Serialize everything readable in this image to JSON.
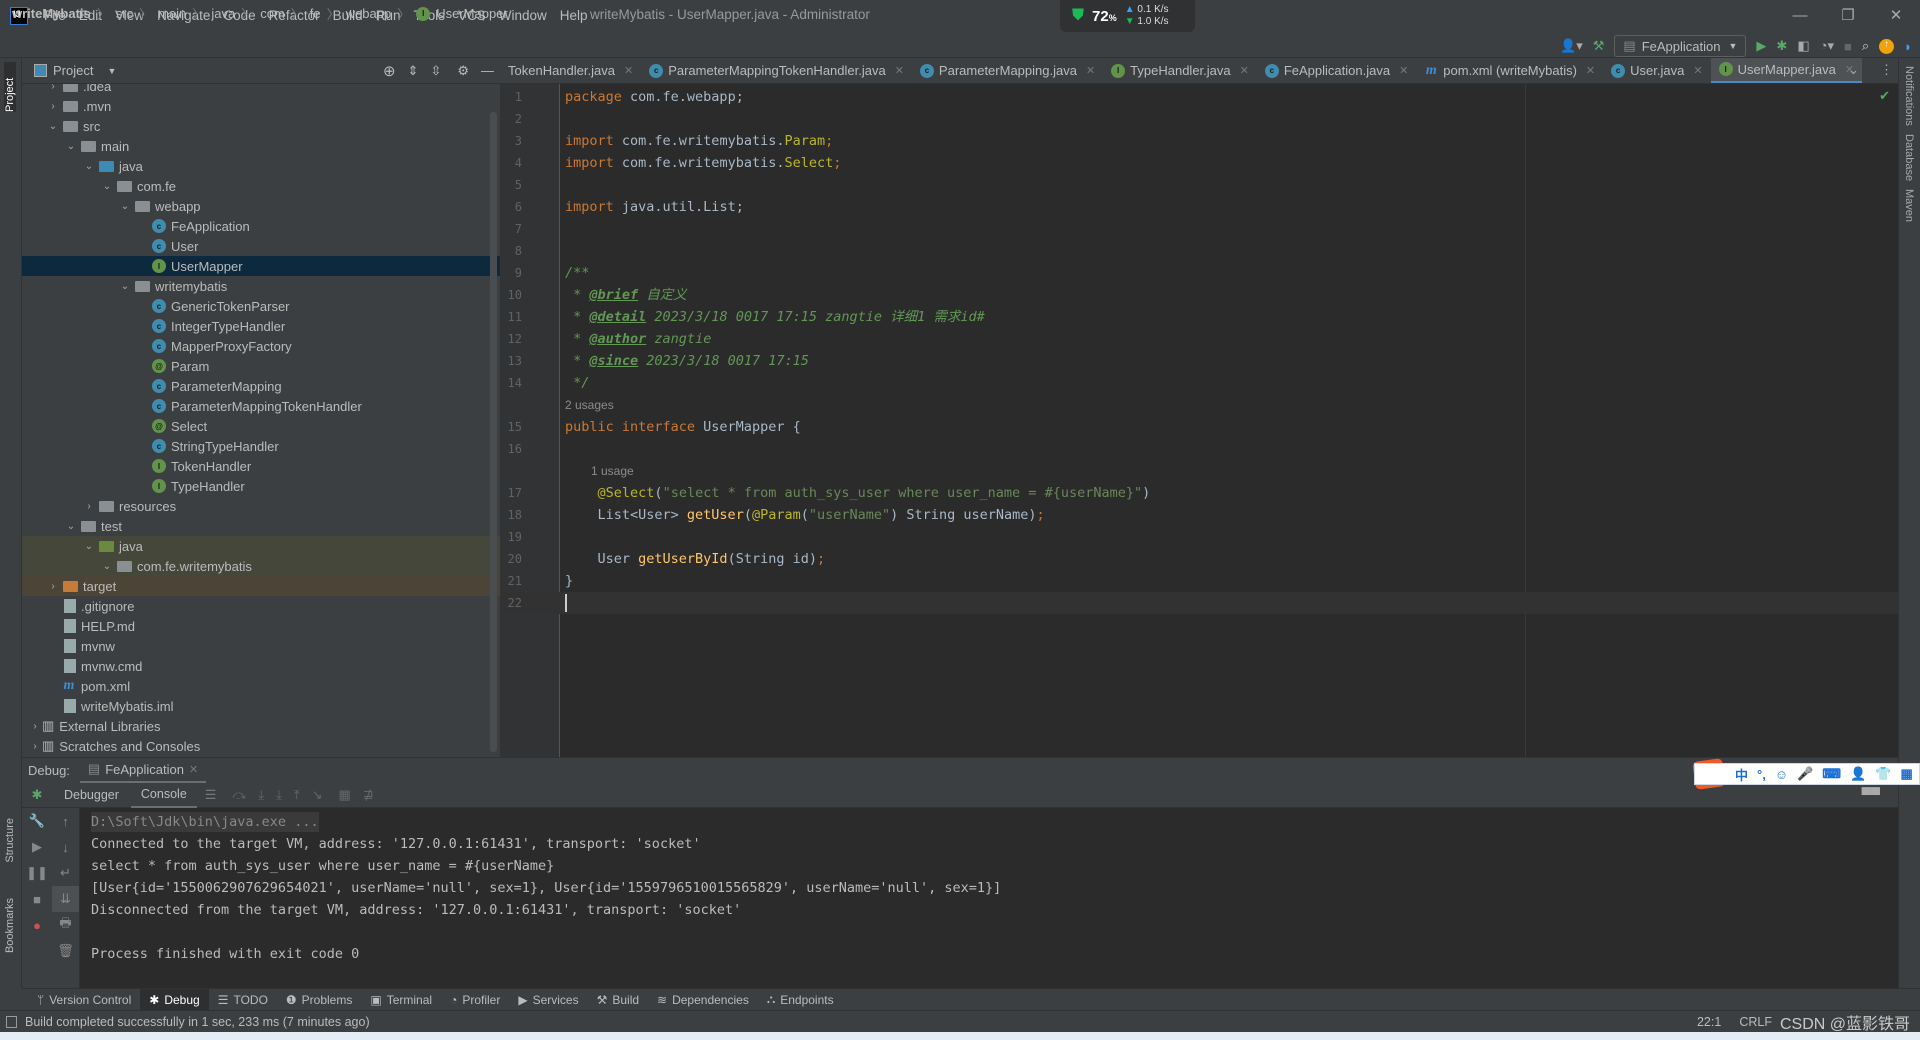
{
  "app": {
    "window_title": "writeMybatis - UserMapper.java - Administrator",
    "logo": "IJ"
  },
  "menu": [
    "File",
    "Edit",
    "View",
    "Navigate",
    "Code",
    "Refactor",
    "Build",
    "Run",
    "Tools",
    "VCS",
    "Window",
    "Help"
  ],
  "net_widget": {
    "cpu": "72",
    "cpu_unit": "%",
    "up": "0.1",
    "down": "1.0",
    "unit": "K/s"
  },
  "breadcrumb": [
    "writeMybatis",
    "src",
    "main",
    "java",
    "com",
    "fe",
    "webapp",
    "UserMapper"
  ],
  "run_config": "FeApplication",
  "left_strip": {
    "project": "Project",
    "structure": "Structure",
    "bookmarks": "Bookmarks"
  },
  "right_strip": [
    "Notifications",
    "Database",
    "Maven"
  ],
  "project_panel": {
    "title": "Project",
    "tree": [
      {
        "label": ".idea",
        "depth": 1,
        "kind": "folder",
        "chev": "›"
      },
      {
        "label": ".mvn",
        "depth": 1,
        "kind": "folder",
        "chev": "›"
      },
      {
        "label": "src",
        "depth": 1,
        "kind": "folder",
        "chev": "⌄"
      },
      {
        "label": "main",
        "depth": 2,
        "kind": "folder",
        "chev": "⌄"
      },
      {
        "label": "java",
        "depth": 3,
        "kind": "src",
        "chev": "⌄"
      },
      {
        "label": "com.fe",
        "depth": 4,
        "kind": "pkg",
        "chev": "⌄"
      },
      {
        "label": "webapp",
        "depth": 5,
        "kind": "pkg",
        "chev": "⌄"
      },
      {
        "label": "FeApplication",
        "depth": 6,
        "kind": "C"
      },
      {
        "label": "User",
        "depth": 6,
        "kind": "C"
      },
      {
        "label": "UserMapper",
        "depth": 6,
        "kind": "I",
        "selected": true
      },
      {
        "label": "writemybatis",
        "depth": 5,
        "kind": "pkg",
        "chev": "⌄"
      },
      {
        "label": "GenericTokenParser",
        "depth": 6,
        "kind": "C"
      },
      {
        "label": "IntegerTypeHandler",
        "depth": 6,
        "kind": "C"
      },
      {
        "label": "MapperProxyFactory",
        "depth": 6,
        "kind": "C"
      },
      {
        "label": "Param",
        "depth": 6,
        "kind": "A"
      },
      {
        "label": "ParameterMapping",
        "depth": 6,
        "kind": "C"
      },
      {
        "label": "ParameterMappingTokenHandler",
        "depth": 6,
        "kind": "C"
      },
      {
        "label": "Select",
        "depth": 6,
        "kind": "A"
      },
      {
        "label": "StringTypeHandler",
        "depth": 6,
        "kind": "C"
      },
      {
        "label": "TokenHandler",
        "depth": 6,
        "kind": "I"
      },
      {
        "label": "TypeHandler",
        "depth": 6,
        "kind": "I"
      },
      {
        "label": "resources",
        "depth": 3,
        "kind": "folder",
        "chev": "›"
      },
      {
        "label": "test",
        "depth": 2,
        "kind": "folder",
        "chev": "⌄"
      },
      {
        "label": "java",
        "depth": 3,
        "kind": "test",
        "chev": "⌄",
        "test": true
      },
      {
        "label": "com.fe.writemybatis",
        "depth": 4,
        "kind": "pkg",
        "chev": "⌄",
        "test": true
      },
      {
        "label": "target",
        "depth": 1,
        "kind": "tgt",
        "chev": "›",
        "excluded": true
      },
      {
        "label": ".gitignore",
        "depth": 1,
        "kind": "file"
      },
      {
        "label": "HELP.md",
        "depth": 1,
        "kind": "file"
      },
      {
        "label": "mvnw",
        "depth": 1,
        "kind": "file"
      },
      {
        "label": "mvnw.cmd",
        "depth": 1,
        "kind": "file"
      },
      {
        "label": "pom.xml",
        "depth": 1,
        "kind": "m"
      },
      {
        "label": "writeMybatis.iml",
        "depth": 1,
        "kind": "file"
      },
      {
        "label": "External Libraries",
        "depth": 0,
        "kind": "lib",
        "chev": "›"
      },
      {
        "label": "Scratches and Consoles",
        "depth": 0,
        "kind": "lib",
        "chev": "›"
      }
    ]
  },
  "editor_tabs": [
    {
      "label": "TokenHandler.java",
      "icon": "I"
    },
    {
      "label": "ParameterMappingTokenHandler.java",
      "icon": "C"
    },
    {
      "label": "ParameterMapping.java",
      "icon": "C"
    },
    {
      "label": "TypeHandler.java",
      "icon": "I"
    },
    {
      "label": "FeApplication.java",
      "icon": "C"
    },
    {
      "label": "pom.xml (writeMybatis)",
      "icon": "m"
    },
    {
      "label": "User.java",
      "icon": "C"
    },
    {
      "label": "UserMapper.java",
      "icon": "I",
      "active": true
    }
  ],
  "code": [
    {
      "n": "1",
      "tokens": [
        [
          "keyword",
          "package "
        ],
        [
          "plain",
          "com.fe.webapp;"
        ]
      ]
    },
    {
      "n": "2",
      "tokens": []
    },
    {
      "n": "3",
      "tokens": [
        [
          "keyword",
          "import "
        ],
        [
          "plain",
          "com.fe.writemybatis."
        ],
        [
          "annotation",
          "Param"
        ],
        [
          "keyword",
          ";"
        ]
      ]
    },
    {
      "n": "4",
      "tokens": [
        [
          "keyword",
          "import "
        ],
        [
          "plain",
          "com.fe.writemybatis."
        ],
        [
          "annotation",
          "Select"
        ],
        [
          "keyword",
          ";"
        ]
      ]
    },
    {
      "n": "5",
      "tokens": []
    },
    {
      "n": "6",
      "tokens": [
        [
          "keyword",
          "import "
        ],
        [
          "plain",
          "java.util.List;"
        ]
      ]
    },
    {
      "n": "7",
      "tokens": []
    },
    {
      "n": "8",
      "tokens": []
    },
    {
      "n": "9",
      "tokens": [
        [
          "doc",
          "/**"
        ]
      ]
    },
    {
      "n": "10",
      "tokens": [
        [
          "doc",
          " * "
        ],
        [
          "doctag",
          "@brief"
        ],
        [
          "doc",
          " 自定义"
        ]
      ]
    },
    {
      "n": "11",
      "tokens": [
        [
          "doc",
          " * "
        ],
        [
          "doctag",
          "@detail"
        ],
        [
          "doc",
          " 2023/3/18 0017 17:15 zangtie 详细1 需求id#"
        ]
      ]
    },
    {
      "n": "12",
      "tokens": [
        [
          "doc",
          " * "
        ],
        [
          "doctag",
          "@author"
        ],
        [
          "doc",
          " zangtie"
        ]
      ]
    },
    {
      "n": "13",
      "tokens": [
        [
          "doc",
          " * "
        ],
        [
          "doctag",
          "@since"
        ],
        [
          "doc",
          " 2023/3/18 0017 17:15"
        ]
      ]
    },
    {
      "n": "14",
      "tokens": [
        [
          "doc",
          " */"
        ]
      ]
    },
    {
      "hint": "2 usages"
    },
    {
      "n": "15",
      "tokens": [
        [
          "keyword",
          "public interface "
        ],
        [
          "plain",
          "UserMapper {"
        ]
      ]
    },
    {
      "n": "16",
      "tokens": []
    },
    {
      "hint": "1 usage",
      "indent": true
    },
    {
      "n": "17",
      "tokens": [
        [
          "plain",
          "    "
        ],
        [
          "annotation",
          "@Select"
        ],
        [
          "plain",
          "("
        ],
        [
          "string",
          "\"select * from auth_sys_user where user_name = #{userName}\""
        ],
        [
          "plain",
          ")"
        ]
      ]
    },
    {
      "n": "18",
      "tokens": [
        [
          "plain",
          "    List<User> "
        ],
        [
          "method",
          "getUser"
        ],
        [
          "plain",
          "("
        ],
        [
          "annotation",
          "@Param"
        ],
        [
          "plain",
          "("
        ],
        [
          "string",
          "\"userName\""
        ],
        [
          "plain",
          ") String userName)"
        ],
        [
          "keyword",
          ";"
        ]
      ]
    },
    {
      "n": "19",
      "tokens": []
    },
    {
      "n": "20",
      "tokens": [
        [
          "plain",
          "    User "
        ],
        [
          "method",
          "getUserById"
        ],
        [
          "plain",
          "(String id)"
        ],
        [
          "keyword",
          ";"
        ]
      ]
    },
    {
      "n": "21",
      "tokens": [
        [
          "plain",
          "}"
        ]
      ]
    },
    {
      "n": "22",
      "tokens": [],
      "current": true
    }
  ],
  "debug": {
    "label": "Debug:",
    "session": "FeApplication",
    "tabs": [
      "Debugger",
      "Console"
    ],
    "active_tab": "Console",
    "console": [
      "D:\\Soft\\Jdk\\bin\\java.exe ...",
      "Connected to the target VM, address: '127.0.0.1:61431', transport: 'socket'",
      "select * from auth_sys_user where user_name = #{userName}",
      "[User{id='1550062907629654021', userName='null', sex=1}, User{id='1559796510015565829', userName='null', sex=1}]",
      "Disconnected from the target VM, address: '127.0.0.1:61431', transport: 'socket'",
      "",
      "Process finished with exit code 0"
    ]
  },
  "bottom_tabs": [
    {
      "label": "Version Control",
      "icon": "ᛘ"
    },
    {
      "label": "Debug",
      "icon": "✱",
      "active": true
    },
    {
      "label": "TODO",
      "icon": "☰"
    },
    {
      "label": "Problems",
      "icon": "❶"
    },
    {
      "label": "Terminal",
      "icon": "▣"
    },
    {
      "label": "Profiler",
      "icon": "◔"
    },
    {
      "label": "Services",
      "icon": "▶"
    },
    {
      "label": "Build",
      "icon": "⚒"
    },
    {
      "label": "Dependencies",
      "icon": "≋"
    },
    {
      "label": "Endpoints",
      "icon": "⛬"
    }
  ],
  "status": {
    "message": "Build completed successfully in 1 sec, 233 ms (7 minutes ago)",
    "position": "22:1",
    "line_ending": "CRLF",
    "watermark": "CSDN @蓝影铁哥"
  },
  "ime": {
    "items": [
      "中",
      "°,",
      "☺",
      "🎤",
      "⌨",
      "👤",
      "👕",
      "▦"
    ]
  }
}
